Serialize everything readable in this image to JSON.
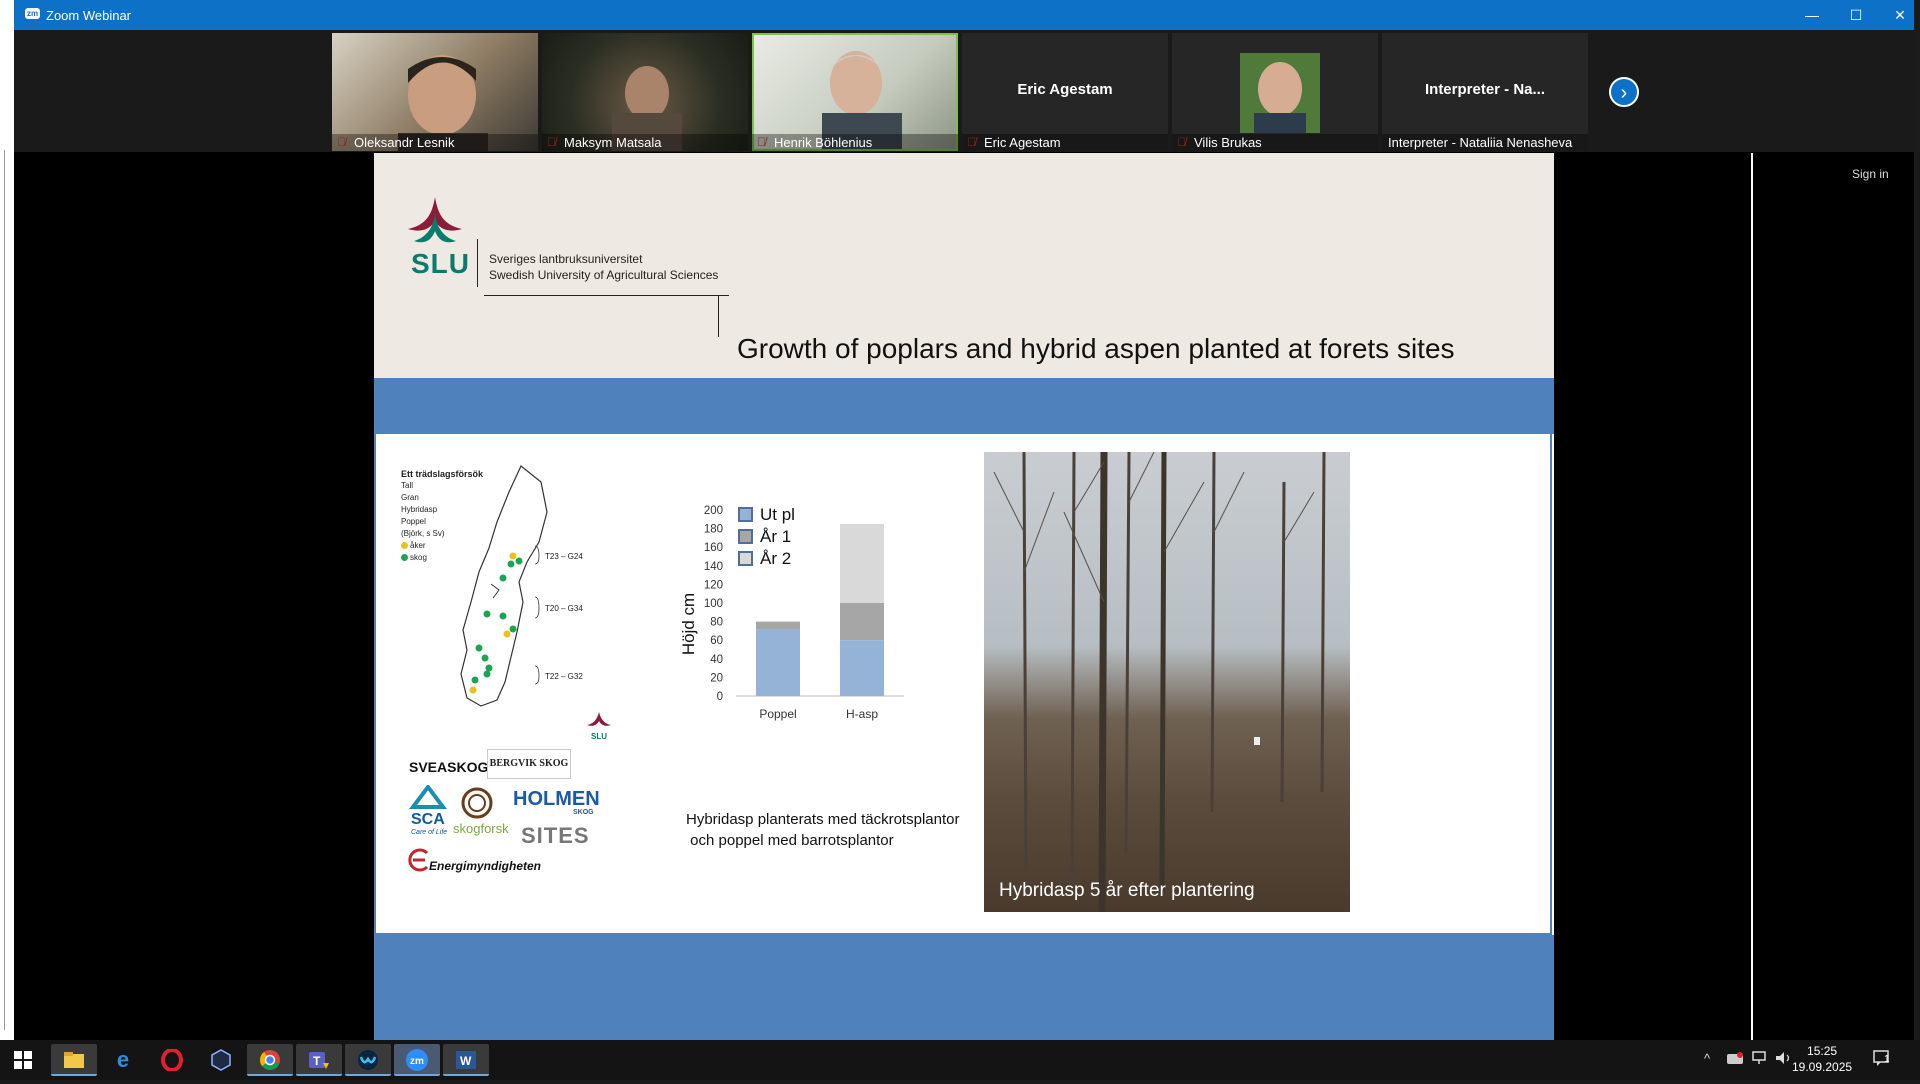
{
  "window": {
    "title": "Zoom Webinar",
    "app_badge": "zm"
  },
  "participants": [
    {
      "name": "Oleksandr Lesnik",
      "video": true,
      "muted": true
    },
    {
      "name": "Maksym Matsala",
      "video": true,
      "muted": true
    },
    {
      "name": "Henrik Böhlenius",
      "video": true,
      "muted": true,
      "active_speaker": true
    },
    {
      "name": "Eric Agestam",
      "video": false,
      "display_name": "Eric Agestam",
      "muted": true
    },
    {
      "name": "Vilis Brukas",
      "video": true,
      "muted": true
    },
    {
      "name": "Interpreter - Nataliia Nenasheva",
      "video": false,
      "display_name": "Interpreter - Na...",
      "muted": false
    }
  ],
  "share": {
    "sign_in": "Sign in"
  },
  "slide": {
    "org_line1": "Sveriges lantbruksuniversitet",
    "org_line2": "Swedish University of Agricultural Sciences",
    "org_abbr": "SLU",
    "title": "Growth of poplars and hybrid aspen planted at forets sites",
    "map": {
      "legend_title": "Ett trädslagsförsök",
      "legend_items": [
        "Tall",
        "Gran",
        "Hybridasp",
        "Poppel",
        "(Björk, s Sv)"
      ],
      "site_types": [
        {
          "label": "åker",
          "color": "#e8c21a"
        },
        {
          "label": "skog",
          "color": "#1aa553"
        }
      ],
      "zones": [
        "T23 – G24",
        "T20 – G34",
        "T22 – G32"
      ],
      "map_logo": "SLU"
    },
    "logos": [
      "SVEASKOG",
      "BERGVIK SKOG",
      "SCA",
      "Care of Life",
      "skogforsk",
      "HOLMEN",
      "SKOG",
      "SITES",
      "Energimyndigheten"
    ],
    "caption_line1": "Hybridasp planterats med täckrotsplantor",
    "caption_line2": " och poppel med barrotsplantor",
    "photo_caption": "Hybridasp 5 år efter plantering"
  },
  "chart_data": {
    "type": "bar",
    "stacked": true,
    "categories": [
      "Poppel",
      "H-asp"
    ],
    "series": [
      {
        "name": "Ut pl",
        "values": [
          72,
          60
        ],
        "color": "#95b3d7"
      },
      {
        "name": "År 1",
        "values": [
          8,
          40
        ],
        "color": "#a6a6a6"
      },
      {
        "name": "År 2",
        "values": [
          0,
          85
        ],
        "color": "#d9d9d9"
      }
    ],
    "ylabel": "Höjd cm",
    "ylim": [
      0,
      200
    ],
    "yticks": [
      0,
      20,
      40,
      60,
      80,
      100,
      120,
      140,
      160,
      180,
      200
    ],
    "legend_position": "top-left"
  },
  "taskbar": {
    "time": "15:25",
    "date": "19.09.2025",
    "notification_count": "1",
    "apps": [
      "start-icon",
      "file-explorer-icon",
      "internet-explorer-icon",
      "opera-icon",
      "app-icon",
      "chrome-icon",
      "teams-icon",
      "webex-icon",
      "zoom-icon",
      "word-icon"
    ]
  }
}
